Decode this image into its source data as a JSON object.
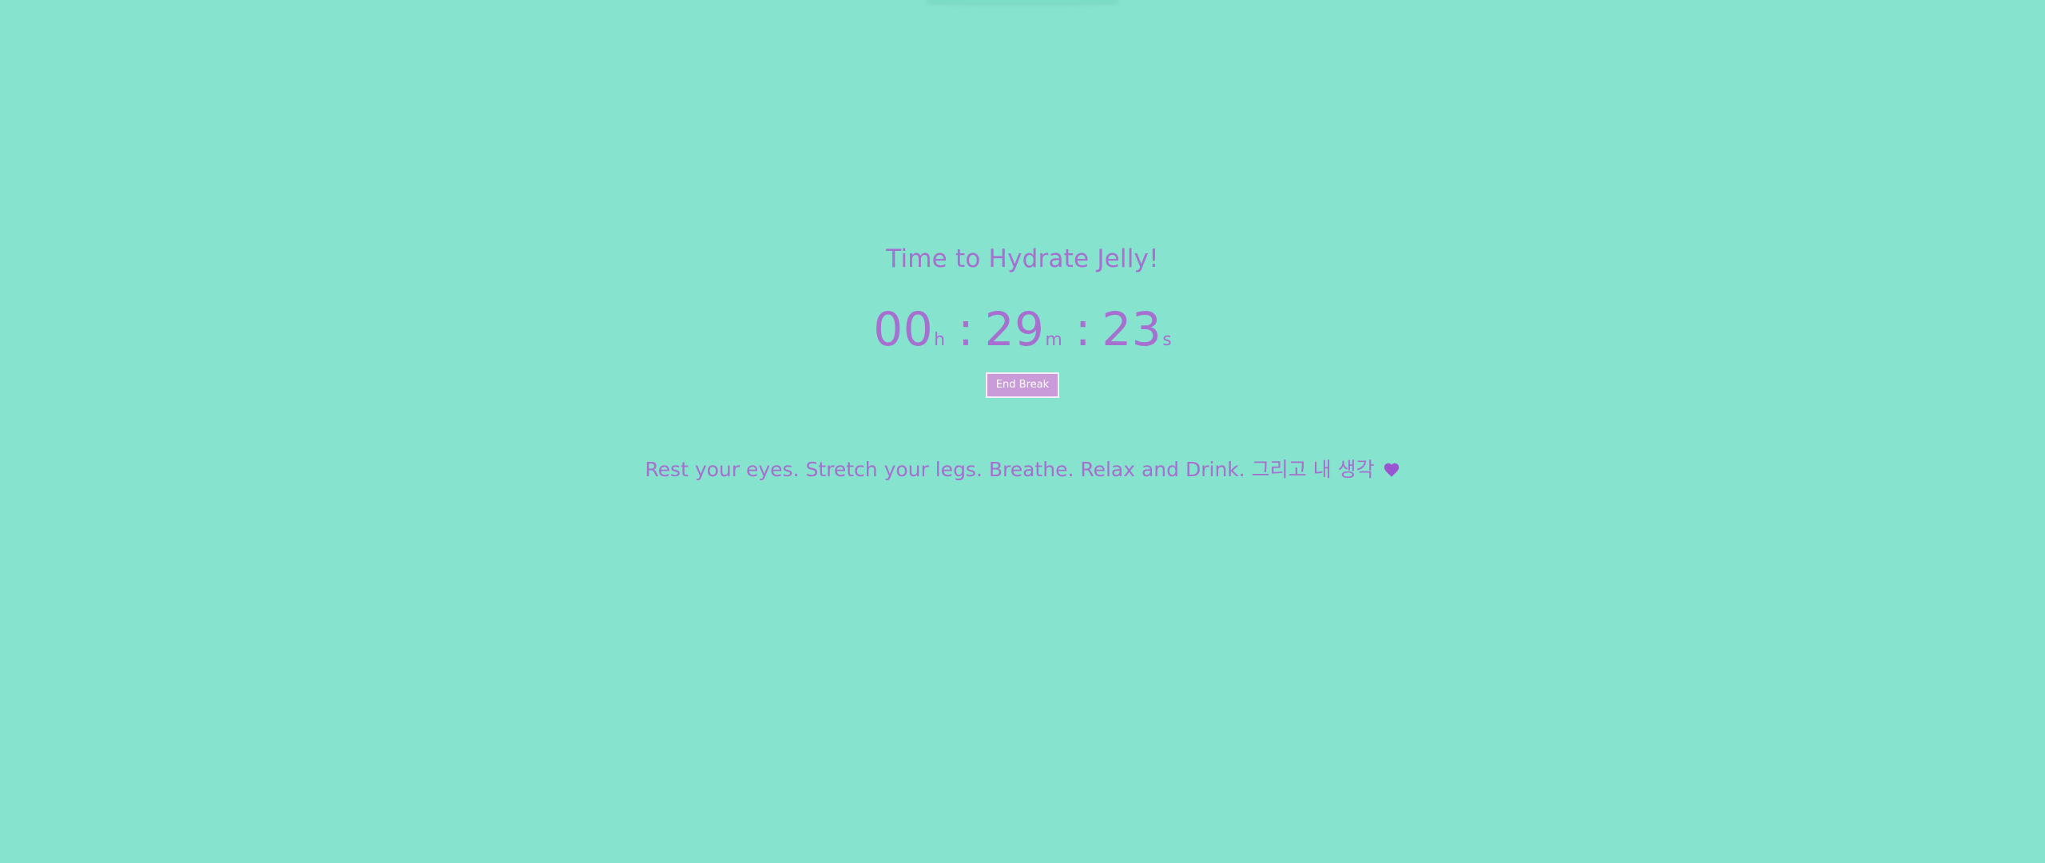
{
  "app": {
    "background_color": "#86e3cd",
    "accent_color": "#a66fd0"
  },
  "main": {
    "title": "Time to Hydrate Jelly!",
    "timer": {
      "hours": "00",
      "hours_unit": "h",
      "minutes": "29",
      "minutes_unit": "m",
      "seconds": "23",
      "seconds_unit": "s",
      "separator": ":"
    },
    "end_button_label": "End Break",
    "message": "Rest your eyes. Stretch your legs. Breathe. Relax and Drink. 그리고 내 생각",
    "message_icon": "heart-icon"
  }
}
